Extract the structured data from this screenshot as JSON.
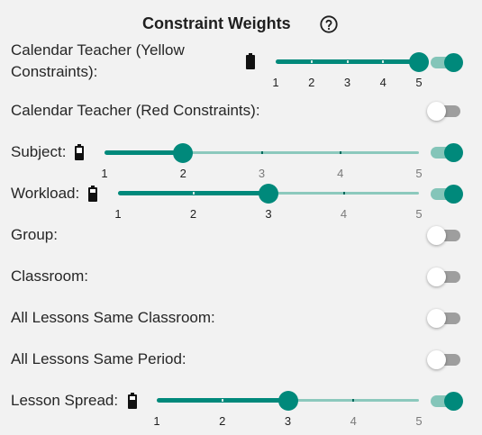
{
  "title": "Constraint Weights",
  "help_icon": "question-circle-icon",
  "colors": {
    "accent": "#00897b",
    "accent_light": "#8cc9bd",
    "toggle_off_track": "#9e9e9e"
  },
  "rows": [
    {
      "id": "calendar-teacher-yellow",
      "label": "Calendar Teacher (Yellow Constraints):",
      "battery_icon": true,
      "slider": {
        "min": 1,
        "max": 5,
        "value": 5,
        "ticks": [
          "1",
          "2",
          "3",
          "4",
          "5"
        ]
      },
      "enabled": true
    },
    {
      "id": "calendar-teacher-red",
      "label": "Calendar Teacher (Red Constraints):",
      "battery_icon": false,
      "enabled": false
    },
    {
      "id": "subject",
      "label": "Subject:",
      "battery_icon": true,
      "slider": {
        "min": 1,
        "max": 5,
        "value": 2,
        "ticks": [
          "1",
          "2",
          "3",
          "4",
          "5"
        ]
      },
      "enabled": true
    },
    {
      "id": "workload",
      "label": "Workload:",
      "battery_icon": true,
      "slider": {
        "min": 1,
        "max": 5,
        "value": 3,
        "ticks": [
          "1",
          "2",
          "3",
          "4",
          "5"
        ]
      },
      "enabled": true
    },
    {
      "id": "group",
      "label": "Group:",
      "battery_icon": false,
      "enabled": false
    },
    {
      "id": "classroom",
      "label": "Classroom:",
      "battery_icon": false,
      "enabled": false
    },
    {
      "id": "all-lessons-same-classroom",
      "label": "All Lessons Same Classroom:",
      "battery_icon": false,
      "enabled": false
    },
    {
      "id": "all-lessons-same-period",
      "label": "All Lessons Same Period:",
      "battery_icon": false,
      "enabled": false
    },
    {
      "id": "lesson-spread",
      "label": "Lesson Spread:",
      "battery_icon": true,
      "slider": {
        "min": 1,
        "max": 5,
        "value": 3,
        "ticks": [
          "1",
          "2",
          "3",
          "4",
          "5"
        ]
      },
      "enabled": true
    }
  ]
}
